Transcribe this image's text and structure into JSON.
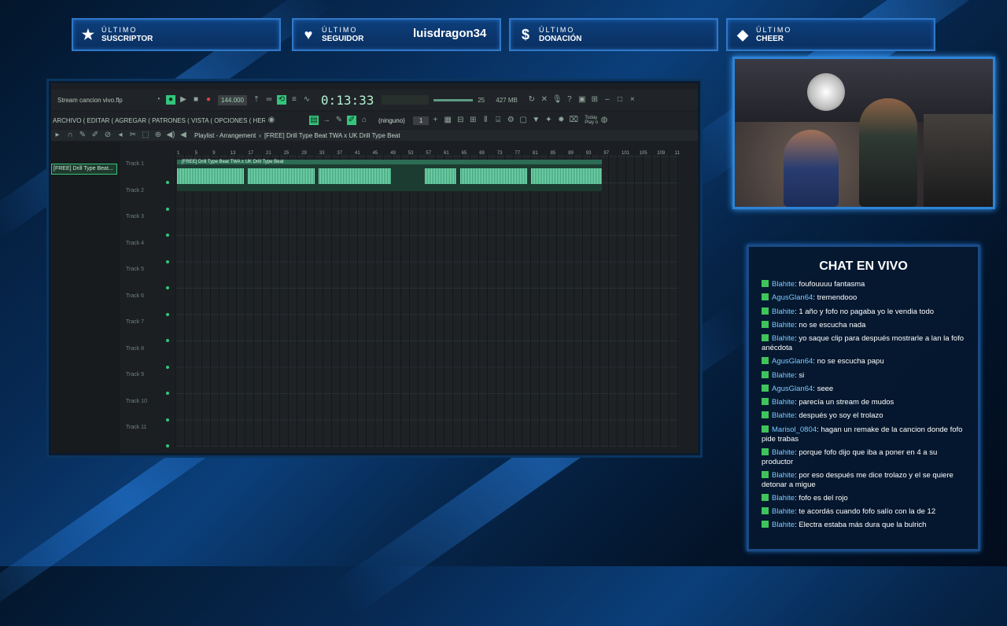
{
  "top_bar": [
    {
      "icon": "star-icon",
      "line1": "ÚLTIMO",
      "line2": "SUSCRIPTOR",
      "value": ""
    },
    {
      "icon": "heart-icon",
      "line1": "ÚLTIMO",
      "line2": "SEGUIDOR",
      "value": "luisdragon34"
    },
    {
      "icon": "dollar-icon",
      "line1": "ÚLTIMO",
      "line2": "DONACIÓN",
      "value": ""
    },
    {
      "icon": "diamond-icon",
      "line1": "ÚLTIMO",
      "line2": "CHEER",
      "value": ""
    }
  ],
  "daw": {
    "project_title": "Stream cancion vivo.flp",
    "tempo": "144.000",
    "time": "0:13:33",
    "memory": "427 MB",
    "cpu": "25",
    "menu": "ARCHIVO ( EDITAR ( AGREGAR ( PATRONES ( VISTA ( OPCIONES ( HERRAMIENTAS (AYUD",
    "pattern_label": "(ninguno)",
    "pattern_number": "1",
    "news_label": "Today\nPlay o",
    "playlist_title": "Playlist - Arrangement",
    "playlist_path": "[FREE] Drill Type Beat TWA x UK Drill Type Beat",
    "sidebar_clip": "[FREE] Drill Type Beat...",
    "clip_label": "[FREE] Drill Type Beat TWA x UK Drill Type Beat",
    "ruler": [
      "1",
      "5",
      "9",
      "13",
      "17",
      "21",
      "25",
      "29",
      "33",
      "37",
      "41",
      "45",
      "49",
      "53",
      "57",
      "61",
      "65",
      "69",
      "73",
      "77",
      "81",
      "85",
      "89",
      "93",
      "97",
      "101",
      "105",
      "109",
      "11"
    ],
    "tracks": [
      "Track 1",
      "Track 2",
      "Track 3",
      "Track 4",
      "Track 5",
      "Track 6",
      "Track 7",
      "Track 8",
      "Track 9",
      "Track 10",
      "Track 11"
    ]
  },
  "chat": {
    "title": "CHAT EN VIVO",
    "messages": [
      {
        "user": "Blahite",
        "text": "foufouuuu fantasma"
      },
      {
        "user": "AgusGlan64",
        "text": "tremendooo"
      },
      {
        "user": "Blahite",
        "text": "1 año y fofo no pagaba yo le vendia todo"
      },
      {
        "user": "Blahite",
        "text": "no se escucha nada"
      },
      {
        "user": "Blahite",
        "text": "yo saque clip para después mostrarle a lan la fofo anécdota"
      },
      {
        "user": "AgusGlan64",
        "text": "no se escucha papu"
      },
      {
        "user": "Blahite",
        "text": "si"
      },
      {
        "user": "AgusGlan64",
        "text": "seee"
      },
      {
        "user": "Blahite",
        "text": "parecía un stream de mudos"
      },
      {
        "user": "Blahite",
        "text": "después yo soy el trolazo"
      },
      {
        "user": "Marisol_0804",
        "text": "hagan un remake de la cancion donde fofo pide trabas"
      },
      {
        "user": "Blahite",
        "text": "porque fofo dijo que iba a poner en 4 a su productor"
      },
      {
        "user": "Blahite",
        "text": "por eso después me dice trolazo y el se quiere detonar a migue"
      },
      {
        "user": "Blahite",
        "text": "fofo es del rojo"
      },
      {
        "user": "Blahite",
        "text": "te acordás cuando fofo salío con la de 12"
      },
      {
        "user": "Blahite",
        "text": "Electra estaba más dura que la bulrich"
      }
    ]
  }
}
